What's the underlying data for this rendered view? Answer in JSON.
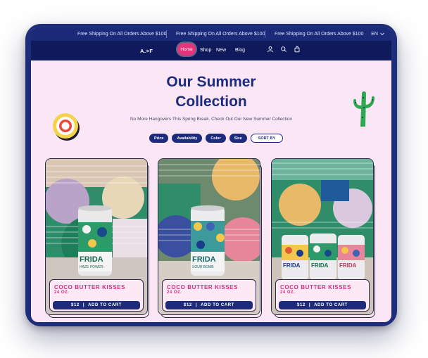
{
  "announcement": {
    "messages": [
      "Free Shipping On All Orders Above $100",
      "Free Shipping On All Orders Above $100",
      "Free Shipping On All Orders Above $100"
    ],
    "language": "EN",
    "language_icon": "chevron-down-icon"
  },
  "nav": {
    "logo": "A.>F",
    "home": "Home",
    "links": [
      "Shop",
      "New",
      "Blog"
    ],
    "icons": [
      "user-icon",
      "search-icon",
      "bag-icon"
    ]
  },
  "hero": {
    "title_line1": "Our Summer",
    "title_line2": "Collection",
    "subtitle": "No More Hangovers This Spring Break. Check Out Our New Summer Collection"
  },
  "filters": {
    "chips": [
      "Price",
      "Availability",
      "Color",
      "Size"
    ],
    "sort_label": "SORT BY"
  },
  "products": [
    {
      "name": "COCO BUTTER KISSES",
      "size": "24 OZ.",
      "price": "$12",
      "cta": "ADD TO CART",
      "can_label": "FRIDA",
      "can_sub": "HAZE POWER"
    },
    {
      "name": "COCO BUTTER KISSES",
      "size": "24 OZ.",
      "price": "$12",
      "cta": "ADD TO CART",
      "can_label": "FRIDA",
      "can_sub": "SOUR BOMB"
    },
    {
      "name": "COCO BUTTER KISSES",
      "size": "24 OZ.",
      "price": "$12",
      "cta": "ADD TO CART",
      "can_label": "FRIDA",
      "can_sub": ""
    }
  ],
  "colors": {
    "brand_navy": "#1c2b7a",
    "accent_pink": "#e4347a",
    "background": "#fbe6f6"
  }
}
